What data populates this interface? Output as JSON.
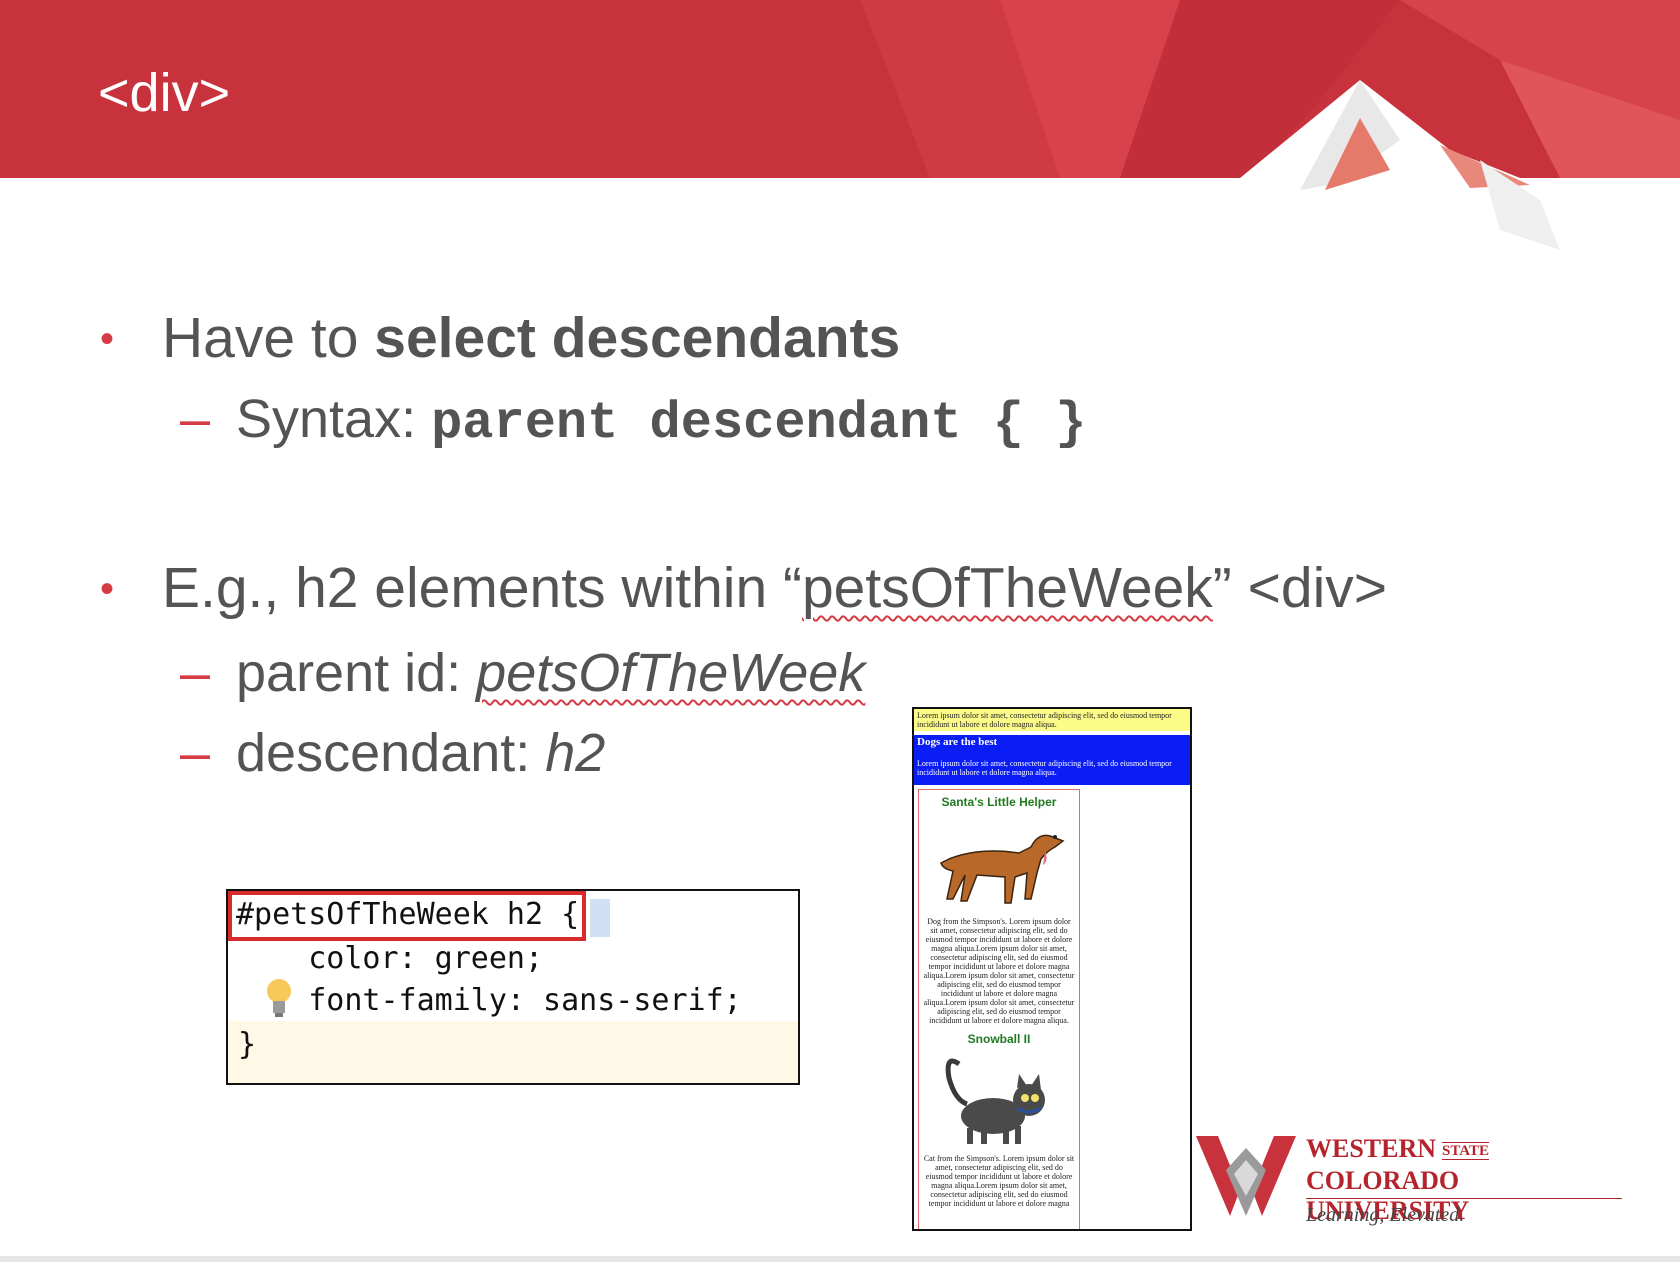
{
  "slide": {
    "title": "<div>",
    "colors": {
      "accent": "#d43b43",
      "banner": "#c8323d",
      "text": "#545454",
      "code_box_border": "#d62b2b",
      "pet_heading": "#1f7a1f"
    }
  },
  "bullets": [
    {
      "plain": "Have to ",
      "bold": "select descendants"
    },
    {
      "sub_label": "Syntax: ",
      "code": "parent descendant { }"
    },
    {
      "pre": "E.g., h2 elements within “",
      "squiggle": "petsOfTheWeek",
      "post": "” <div>"
    },
    {
      "label": "parent id: ",
      "value": "petsOfTheWeek"
    },
    {
      "label": "descendant: ",
      "value": "h2"
    }
  ],
  "code": {
    "selector": "#petsOfTheWeek h2",
    "open_brace": "{",
    "line2": "    color: green;",
    "line3": "    font-family: sans-serif;",
    "close_brace": "}"
  },
  "preview": {
    "yellow_text": "Lorem ipsum dolor sit amet, consectetur adipiscing elit, sed do eiusmod tempor incididunt ut labore et dolore magna aliqua.",
    "blue_heading": "Dogs are the best",
    "blue_text": "Lorem ipsum dolor sit amet, consectetur adipiscing elit, sed do eiusmod tempor incididunt ut labore et dolore magna aliqua.",
    "pet1_heading": "Santa's Little Helper",
    "pet1_text": "Dog from the Simpson's. Lorem ipsum dolor sit amet, consectetur adipiscing elit, sed do eiusmod tempor incididunt ut labore et dolore magna aliqua.Lorem ipsum dolor sit amet, consectetur adipiscing elit, sed do eiusmod tempor incididunt ut labore et dolore magna aliqua.Lorem ipsum dolor sit amet, consectetur adipiscing elit, sed do eiusmod tempor incididunt ut labore et dolore magna aliqua.Lorem ipsum dolor sit amet, consectetur adipiscing elit, sed do eiusmod tempor incididunt ut labore et dolore magna aliqua.",
    "pet2_heading": "Snowball II",
    "pet2_text": "Cat from the Simpson's. Lorem ipsum dolor sit amet, consectetur adipiscing elit, sed do eiusmod tempor incididunt ut labore et dolore magna aliqua.Lorem ipsum dolor sit amet, consectetur adipiscing elit, sed do eiusmod tempor incididunt ut labore et dolore magna"
  },
  "logo": {
    "line1": "WESTERN",
    "state": "STATE",
    "line2": "COLORADO UNIVERSITY",
    "tagline": "Learning, Elevated."
  }
}
